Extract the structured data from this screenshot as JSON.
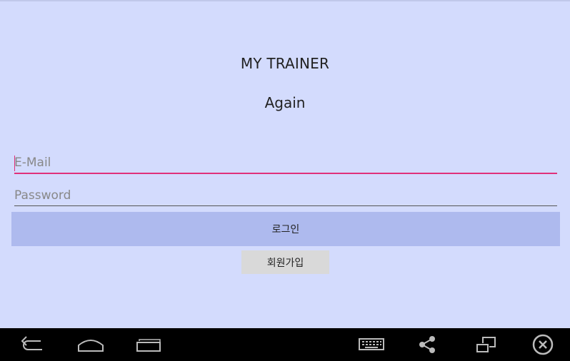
{
  "app": {
    "title": "MY TRAINER",
    "subtitle": "Again"
  },
  "form": {
    "email": {
      "placeholder": "E-Mail",
      "value": ""
    },
    "password": {
      "placeholder": "Password",
      "value": ""
    },
    "login_label": "로그인",
    "signup_label": "회원가입"
  },
  "navbar": {
    "icons": [
      "back-icon",
      "home-icon",
      "recent-apps-icon",
      "keyboard-icon",
      "share-icon",
      "resize-window-icon",
      "close-circle-icon"
    ]
  },
  "colors": {
    "background": "#d3dbfd",
    "accent": "#e0307a",
    "login_button": "#aebaee",
    "signup_button": "#d9d9d9",
    "navbar": "#000000"
  }
}
